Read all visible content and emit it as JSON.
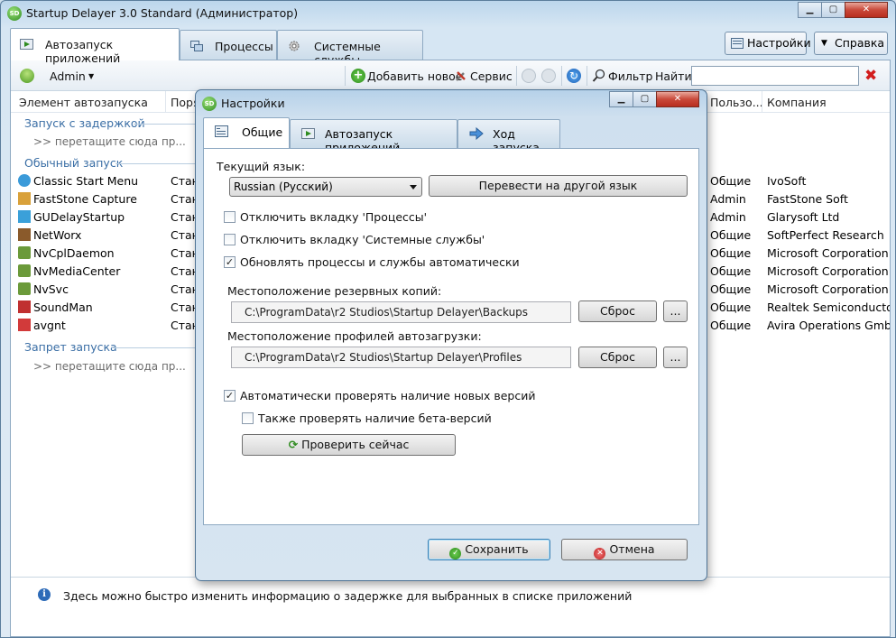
{
  "window": {
    "title": "Startup Delayer 3.0 Standard (Администратор)",
    "app_icon": "SD"
  },
  "tabs": [
    {
      "label": "Автозапуск приложений"
    },
    {
      "label": "Процессы"
    },
    {
      "label": "Системные службы"
    }
  ],
  "header_buttons": {
    "settings": "Настройки",
    "help": "Справка"
  },
  "toolbar": {
    "user": "Admin",
    "add_new": "Добавить новое",
    "service": "Сервис",
    "filter": "Фильтр",
    "find_label": "Найти:",
    "find_value": ""
  },
  "columns": {
    "element": "Элемент автозапуска",
    "order": "Поря",
    "user": "Пользо...",
    "company": "Компания"
  },
  "groups": {
    "delayed": "Запуск с задержкой",
    "normal": "Обычный запуск",
    "blocked": "Запрет запуска",
    "drop_hint": ">> перетащите сюда пр..."
  },
  "rows": [
    {
      "name": "Classic Start Menu",
      "type": "Станд",
      "user": "Общие",
      "company": "IvoSoft"
    },
    {
      "name": "FastStone Capture",
      "type": "Станд",
      "user": "Admin",
      "company": "FastStone Soft"
    },
    {
      "name": "GUDelayStartup",
      "type": "Станд",
      "user": "Admin",
      "company": "Glarysoft Ltd"
    },
    {
      "name": "NetWorx",
      "type": "Станд",
      "user": "Общие",
      "company": "SoftPerfect Research"
    },
    {
      "name": "NvCplDaemon",
      "type": "Станд",
      "user": "Общие",
      "company": "Microsoft Corporation"
    },
    {
      "name": "NvMediaCenter",
      "type": "Станд",
      "user": "Общие",
      "company": "Microsoft Corporation"
    },
    {
      "name": "NvSvc",
      "type": "Станд",
      "user": "Общие",
      "company": "Microsoft Corporation"
    },
    {
      "name": "SoundMan",
      "type": "Станд",
      "user": "Общие",
      "company": "Realtek Semiconductor C"
    },
    {
      "name": "avgnt",
      "type": "Станд",
      "user": "Общие",
      "company": "Avira Operations GmbH"
    }
  ],
  "status": {
    "text": "Здесь можно быстро изменить информацию о задержке для выбранных в списке приложений"
  },
  "dialog": {
    "title": "Настройки",
    "tabs": [
      {
        "label": "Общие"
      },
      {
        "label": "Автозапуск приложений"
      },
      {
        "label": "Ход запуска"
      }
    ],
    "language_label": "Текущий язык:",
    "language_value": "Russian (Русский)",
    "translate_button": "Перевести на другой язык",
    "disable_processes": "Отключить вкладку 'Процессы'",
    "disable_services": "Отключить вкладку 'Системные службы'",
    "auto_update": "Обновлять процессы и службы автоматически",
    "backup_label": "Местоположение резервных копий:",
    "backup_path": "C:\\ProgramData\\r2 Studios\\Startup Delayer\\Backups",
    "profiles_label": "Местоположение профилей автозагрузки:",
    "profiles_path": "C:\\ProgramData\\r2 Studios\\Startup Delayer\\Profiles",
    "reset_button": "Сброс",
    "browse_button": "...",
    "check_updates": "Автоматически проверять наличие новых версий",
    "check_beta": "Также проверять наличие бета-версий",
    "check_now": "Проверить сейчас",
    "save": "Сохранить",
    "cancel": "Отмена",
    "checked_mark": "✓"
  },
  "colors": {
    "accent": "#3a6ea5",
    "close_red": "#c9493a"
  }
}
